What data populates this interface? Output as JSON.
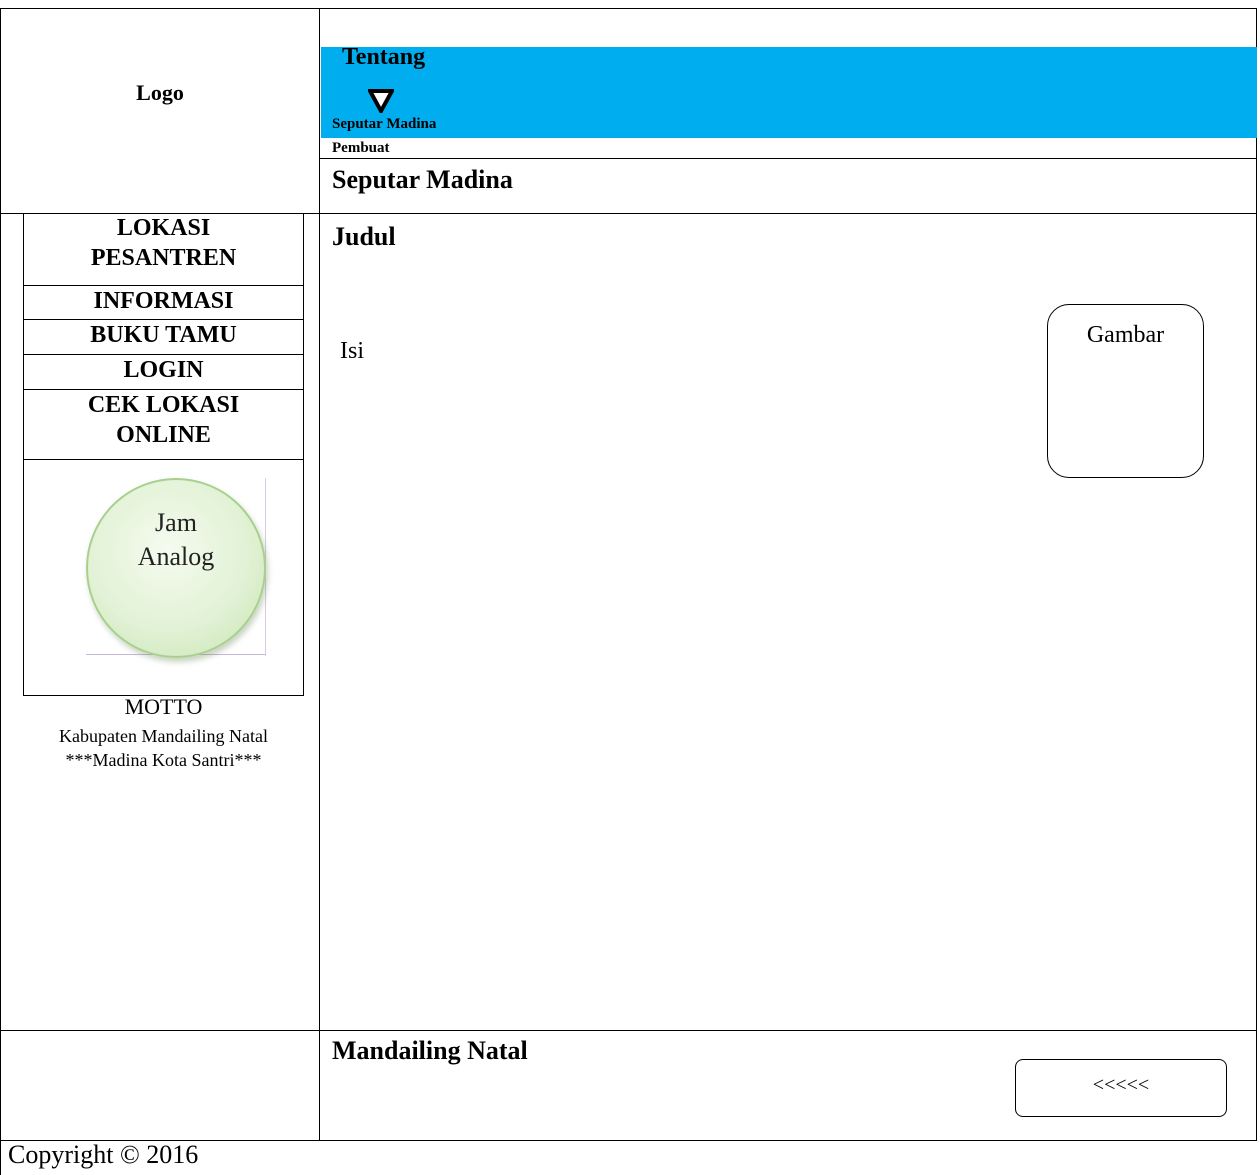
{
  "header": {
    "logo_label": "Logo",
    "banner_title": "Tentang",
    "submenu": [
      "Seputar Madina",
      "Pembuat"
    ],
    "page_title": "Seputar Madina",
    "banner_color": "#00aeef"
  },
  "sidebar": {
    "items": [
      {
        "label_line1": "LOKASI",
        "label_line2": "PESANTREN"
      },
      {
        "label_line1": "INFORMASI"
      },
      {
        "label_line1": "BUKU TAMU"
      },
      {
        "label_line1": "LOGIN"
      },
      {
        "label_line1": "CEK LOKASI",
        "label_line2": "ONLINE"
      }
    ],
    "clock_line1": "Jam",
    "clock_line2": "Analog",
    "motto_title": "MOTTO",
    "motto_line1": "Kabupaten Mandailing Natal",
    "motto_line2": "***Madina Kota Santri***"
  },
  "content": {
    "title": "Judul",
    "body": "Isi",
    "image_label": "Gambar"
  },
  "footer": {
    "title": "Mandailing Natal",
    "back_label": "<<<<<",
    "copyright": "Copyright © 2016"
  },
  "icons": {
    "dropdown": "dropdown-arrow-icon"
  }
}
